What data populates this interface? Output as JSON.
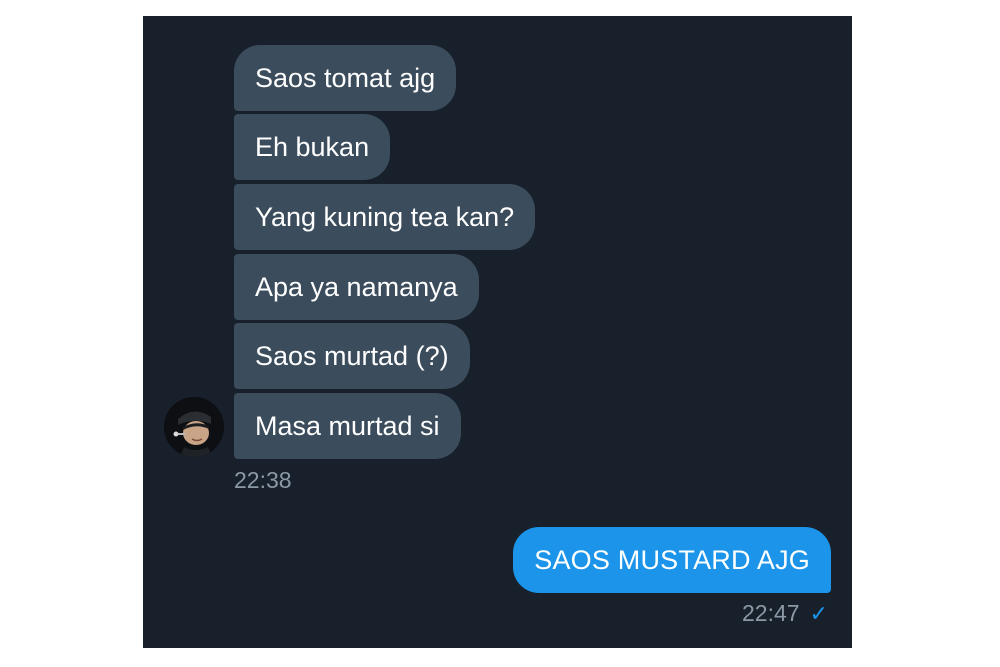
{
  "conversation": {
    "received": [
      {
        "text": "Saos tomat ajg"
      },
      {
        "text": "Eh bukan"
      },
      {
        "text": "Yang kuning tea kan?"
      },
      {
        "text": "Apa ya namanya"
      },
      {
        "text": "Saos murtad (?)"
      },
      {
        "text": "Masa murtad si"
      }
    ],
    "received_time": "22:38",
    "sent": [
      {
        "text": "SAOS MUSTARD AJG"
      }
    ],
    "sent_time": "22:47",
    "sent_status_icon": "checkmark-icon",
    "sent_status_glyph": "✓"
  },
  "colors": {
    "background": "#17202b",
    "received_bubble": "#3b4c5c",
    "sent_bubble": "#1b94e9",
    "timestamp": "#8b98a5"
  }
}
